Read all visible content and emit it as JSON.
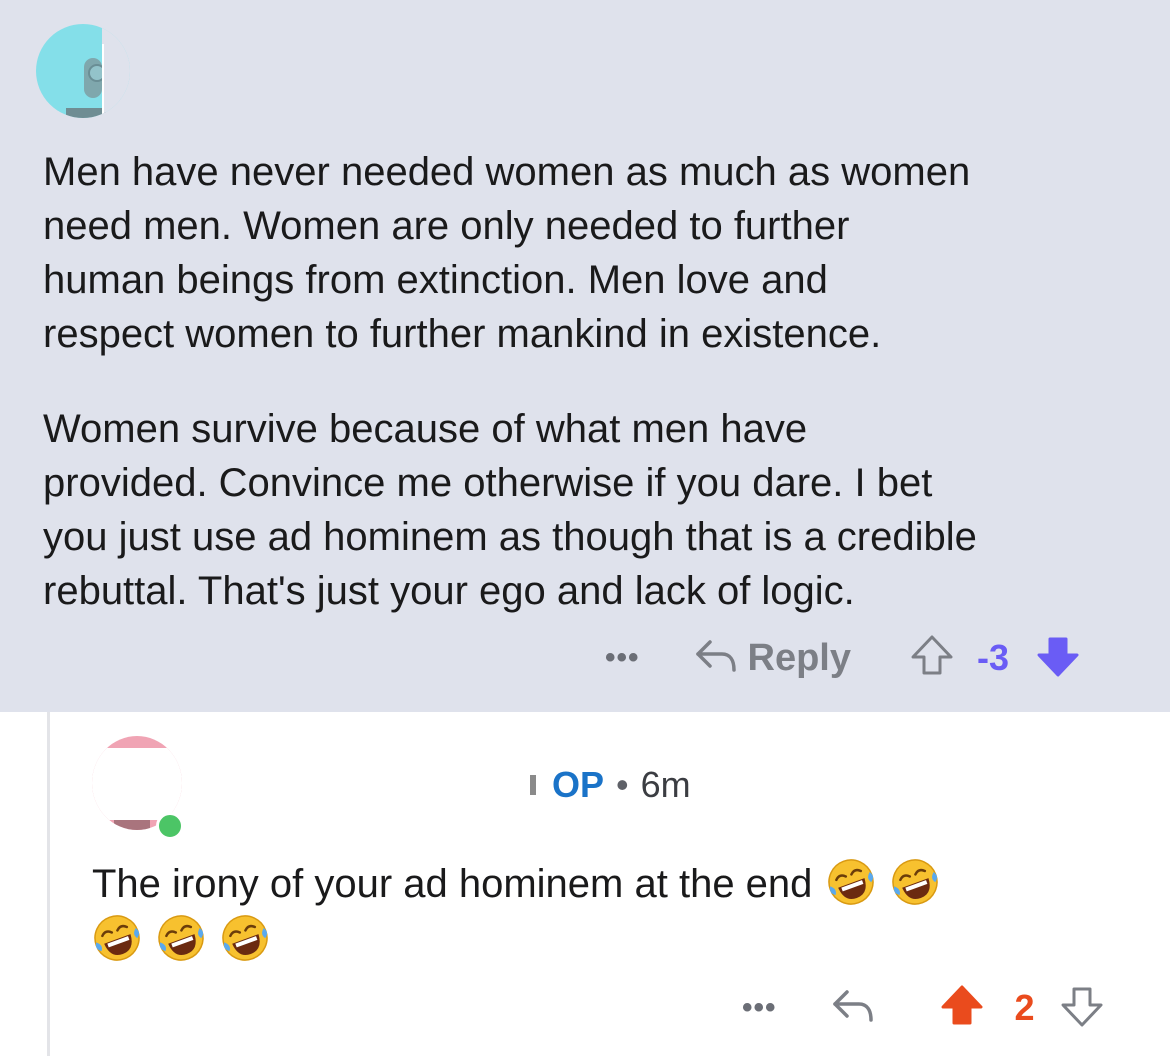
{
  "parent_comment": {
    "paragraphs": [
      "Men have never needed women as much as women\nneed men. Women are only needed to further\nhuman beings from extinction.  Men love and\nrespect women to further mankind in existence.",
      "Women survive because of what men have\nprovided. Convince me otherwise if you dare. I bet\nyou just use ad hominem as though that is a credible\nrebuttal. That's just your ego and lack of logic."
    ],
    "more_label": "•••",
    "reply_label": "Reply",
    "score": "-3",
    "score_color": "#6a5cf5",
    "vote_state": "downvoted"
  },
  "reply_comment": {
    "op_badge": "OP",
    "separator": "•",
    "time": "6m",
    "text": "The irony of your ad hominem at the end",
    "emoji_count": 5,
    "emoji_name": "rolling-on-the-floor-laughing",
    "more_label": "•••",
    "score": "2",
    "score_color": "#ea4b1d",
    "vote_state": "upvoted"
  }
}
